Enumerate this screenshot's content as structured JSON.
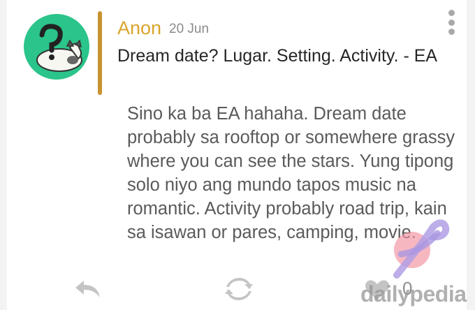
{
  "post": {
    "author": "Anon",
    "date": "20 Jun",
    "question": "Dream date? Lugar. Setting. Activity. - EA",
    "answer": "Sino ka ba EA hahaha. Dream date probably sa rooftop or somewhere grassy where you can see the stars. Yung tipong solo niyo ang mundo tapos music na romantic. Activity probably road trip, kain sa isawan or pares, camping, movie."
  },
  "actions": {
    "reply_icon": "reply-icon",
    "share_icon": "share-icon",
    "like_icon": "heart-icon",
    "like_count": "0",
    "menu_icon": "more-vertical-icon"
  },
  "watermark": {
    "text": "dailypedia"
  },
  "colors": {
    "author": "#d9a42a",
    "accent_bar": "#c89430",
    "avatar_bg": "#2bc48a",
    "icon_gray": "#c4c4c4"
  }
}
